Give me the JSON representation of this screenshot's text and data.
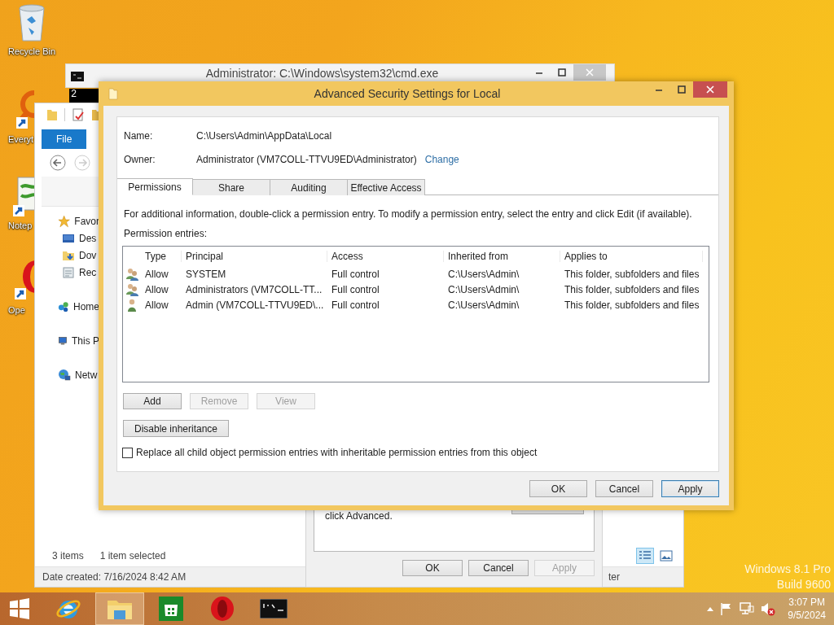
{
  "desktop": {
    "icons": [
      {
        "label": "Recycle Bin",
        "kind": "recycle"
      },
      {
        "label": "Everyt",
        "kind": "everything"
      },
      {
        "label": "Notep",
        "kind": "notepad"
      },
      {
        "label": "Ope",
        "kind": "opera"
      }
    ],
    "edition": [
      "Windows 8.1 Pro",
      "Build 9600"
    ]
  },
  "cmd_window": {
    "title": "Administrator: C:\\Windows\\system32\\cmd.exe",
    "console_text": "2"
  },
  "explorer": {
    "file_tab": "File",
    "sidebar": [
      {
        "label": "Favor",
        "kind": "favorites",
        "children": [
          {
            "label": "Des",
            "kind": "desktop"
          },
          {
            "label": "Dov",
            "kind": "downloads"
          },
          {
            "label": "Rec",
            "kind": "recent"
          }
        ]
      },
      {
        "label": "Home",
        "kind": "homegroup"
      },
      {
        "label": "This P",
        "kind": "pc"
      },
      {
        "label": "Netw",
        "kind": "network"
      }
    ],
    "item_count": "3 items",
    "selection": "1 item selected",
    "details": "Date created: 7/16/2024 8:42 AM",
    "details_end": "ter",
    "views": [
      {
        "kind": "details",
        "selected": true
      },
      {
        "kind": "thumbnails",
        "selected": false
      }
    ]
  },
  "properties_dialog": {
    "text": "click Advanced.",
    "buttons": [
      {
        "label": "OK",
        "disabled": false
      },
      {
        "label": "Cancel",
        "disabled": false
      },
      {
        "label": "Apply",
        "disabled": true
      }
    ]
  },
  "dialog": {
    "title": "Advanced Security Settings for Local",
    "name_label": "Name:",
    "name": "C:\\Users\\Admin\\AppData\\Local",
    "owner_label": "Owner:",
    "owner": "Administrator (VM7COLL-TTVU9ED\\Administrator)",
    "change_link": "Change",
    "tabs": [
      {
        "label": "Permissions",
        "selected": true
      },
      {
        "label": "Share",
        "selected": false
      },
      {
        "label": "Auditing",
        "selected": false
      },
      {
        "label": "Effective Access",
        "selected": false
      }
    ],
    "info": "For additional information, double-click a permission entry. To modify a permission entry, select the entry and click Edit (if available).",
    "entries_label": "Permission entries:",
    "columns": [
      "Type",
      "Principal",
      "Access",
      "Inherited from",
      "Applies to"
    ],
    "rows": [
      {
        "kind": "group",
        "type": "Allow",
        "principal": "SYSTEM",
        "access": "Full control",
        "inherited_from": "C:\\Users\\Admin\\",
        "applies_to": "This folder, subfolders and files"
      },
      {
        "kind": "group",
        "type": "Allow",
        "principal": "Administrators (VM7COLL-TT...",
        "access": "Full control",
        "inherited_from": "C:\\Users\\Admin\\",
        "applies_to": "This folder, subfolders and files"
      },
      {
        "kind": "user",
        "type": "Allow",
        "principal": "Admin (VM7COLL-TTVU9ED\\...",
        "access": "Full control",
        "inherited_from": "C:\\Users\\Admin\\",
        "applies_to": "This folder, subfolders and files"
      }
    ],
    "list_buttons": [
      {
        "label": "Add",
        "disabled": false
      },
      {
        "label": "Remove",
        "disabled": true
      },
      {
        "label": "View",
        "disabled": true
      }
    ],
    "inheritance_button": "Disable inheritance",
    "replace_checkbox": {
      "label": "Replace all child object permission entries with inheritable permission entries from this object",
      "checked": false
    },
    "buttons": [
      {
        "label": "OK",
        "focused": false
      },
      {
        "label": "Cancel",
        "focused": false
      },
      {
        "label": "Apply",
        "focused": true
      }
    ]
  },
  "taskbar": {
    "apps": [
      {
        "kind": "ie",
        "active": false
      },
      {
        "kind": "explorer",
        "active": true
      },
      {
        "kind": "store",
        "active": false
      },
      {
        "kind": "opera",
        "active": false
      },
      {
        "kind": "cmd",
        "active": false
      }
    ],
    "time": "3:07 PM",
    "date": "9/5/2024"
  }
}
